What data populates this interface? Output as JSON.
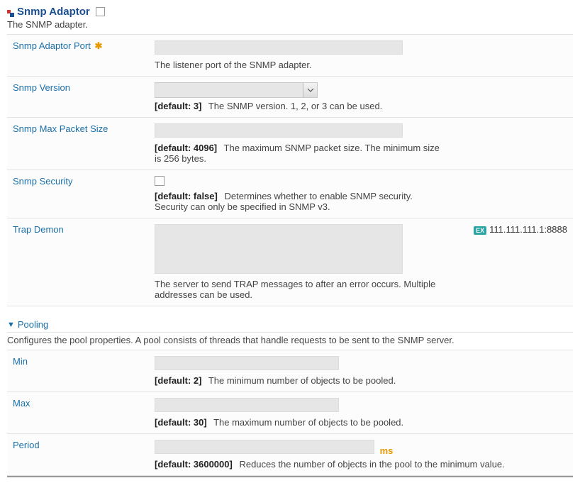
{
  "section": {
    "title": "Snmp Adaptor",
    "desc": "The SNMP adapter."
  },
  "fields": {
    "port": {
      "label": "Snmp Adaptor Port",
      "help": "The listener port of the SNMP adapter."
    },
    "version": {
      "label": "Snmp Version",
      "default": "[default: 3]",
      "help": "The SNMP version. 1, 2, or 3 can be used."
    },
    "maxPacket": {
      "label": "Snmp Max Packet Size",
      "default": "[default: 4096]",
      "help": "The maximum SNMP packet size. The minimum size is 256 bytes."
    },
    "security": {
      "label": "Snmp Security",
      "default": "[default: false]",
      "help": "Determines whether to enable SNMP security. Security can only be specified in SNMP v3."
    },
    "trapDemon": {
      "label": "Trap Demon",
      "help": "The server to send TRAP messages to after an error occurs. Multiple addresses can be used.",
      "exampleBadge": "EX",
      "example": "111.111.111.1:8888"
    }
  },
  "pooling": {
    "title": "Pooling",
    "desc": "Configures the pool properties. A pool consists of threads that handle requests to be sent to the SNMP server.",
    "min": {
      "label": "Min",
      "default": "[default: 2]",
      "help": "The minimum number of objects to be pooled."
    },
    "max": {
      "label": "Max",
      "default": "[default: 30]",
      "help": "The maximum number of objects to be pooled."
    },
    "period": {
      "label": "Period",
      "unit": "ms",
      "default": "[default: 3600000]",
      "help": "Reduces the number of objects in the pool to the minimum value."
    }
  }
}
